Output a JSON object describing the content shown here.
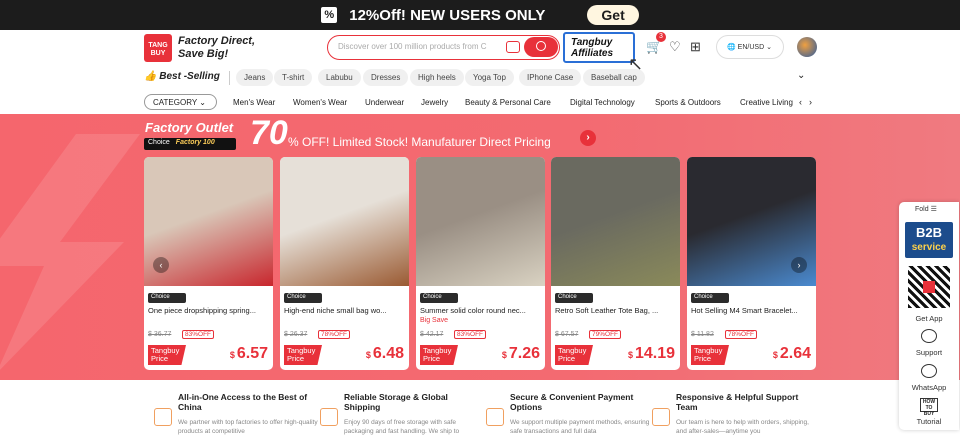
{
  "promo": {
    "percent_icon": "%",
    "text": "12%Off! NEW USERS ONLY",
    "button": "Get"
  },
  "header": {
    "logo_text": "TANG BUY",
    "tagline_line1": "Factory Direct,",
    "tagline_line2": "Save Big!",
    "search_placeholder": "Discover over 100 million products from C",
    "affiliates_line1": "Tangbuy",
    "affiliates_line2": "Affiliates",
    "cart_count": "3",
    "language": "EN/USD"
  },
  "hot": {
    "title": "Best -Selling",
    "pills": [
      "Jeans",
      "T-shirt",
      "Labubu",
      "Dresses",
      "High heels",
      "Yoga Top",
      "IPhone Case",
      "Baseball cap"
    ]
  },
  "cats": {
    "category_label": "CATEGORY",
    "items": [
      "Men's Wear",
      "Women's Wear",
      "Underwear",
      "Jewelry",
      "Beauty & Personal Care",
      "Digital Technology",
      "Sports & Outdoors",
      "Creative Living"
    ]
  },
  "banner": {
    "factory_outlet": "Factory Outlet",
    "choice": "Choice",
    "factory100": "Factory 100",
    "big_num": "70",
    "off_text": "% OFF!  Limited Stock! Manufaturer Direct Pricing"
  },
  "products": [
    {
      "choice": "Choice",
      "name": "One piece dropshipping spring...",
      "old": "$ 36.77",
      "discount": "83%OFF",
      "tag": "Tangbuy Price",
      "currency": "$",
      "price": "6.57",
      "img": "#d9c7b8",
      "img2": "#c8262d"
    },
    {
      "choice": "Choice",
      "name": "High-end niche small bag wo...",
      "old": "$ 26.37",
      "discount": "78%OFF",
      "tag": "Tangbuy Price",
      "currency": "$",
      "price": "6.48",
      "img": "#e6e0d8",
      "img2": "#9a5a32"
    },
    {
      "choice": "Choice",
      "name": "Summer solid color round nec...",
      "big_save": "Big Save",
      "old": "$ 42.17",
      "discount": "83%OFF",
      "tag": "Tangbuy Price",
      "currency": "$",
      "price": "7.26",
      "img": "#9a8f84",
      "img2": "#d9d2c2"
    },
    {
      "choice": "Choice",
      "name": "Retro Soft Leather Tote Bag, ...",
      "old": "$ 67.57",
      "discount": "79%OFF",
      "tag": "Tangbuy Price",
      "currency": "$",
      "price": "14.19",
      "img": "#6a6a60",
      "img2": "#8a8a5a"
    },
    {
      "choice": "Choice",
      "name": "Hot Selling M4 Smart Bracelet...",
      "old": "$ 11.82",
      "discount": "78%OFF",
      "tag": "Tangbuy Price",
      "currency": "$",
      "price": "2.64",
      "img": "#2a2a30",
      "img2": "#4a8ad0"
    }
  ],
  "features": [
    {
      "title": "All-in-One Access to the Best of China",
      "desc": "We partner with top factories to offer high-quality products at competitive"
    },
    {
      "title": "Reliable Storage & Global Shipping",
      "desc": "Enjoy 90 days of free storage with safe packaging and fast handling. We ship to"
    },
    {
      "title": "Secure & Convenient Payment Options",
      "desc": "We support multiple payment methods, ensuring safe transactions and full data"
    },
    {
      "title": "Responsive & Helpful Support Team",
      "desc": "Our team is here to help with orders, shipping, and after-sales—anytime you"
    }
  ],
  "side": {
    "fold": "Fold",
    "b2b": "B2B",
    "service": "service",
    "get_app": "Get App",
    "support": "Support",
    "whatsapp": "WhatsApp",
    "tut_icon": "HOW TO BUY",
    "tutorial": "Tutorial"
  }
}
